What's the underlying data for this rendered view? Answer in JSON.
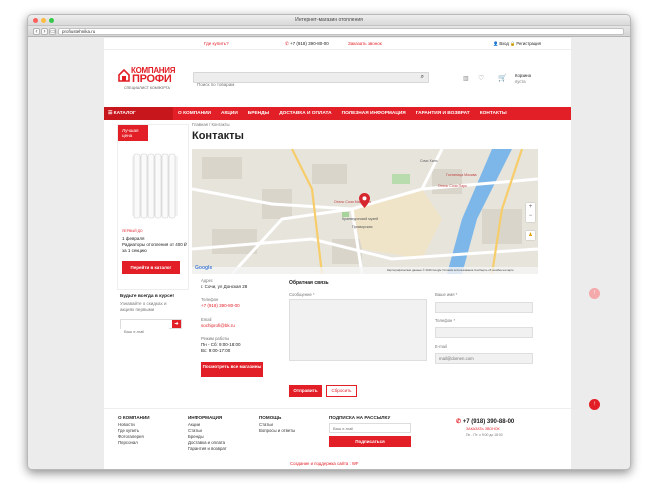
{
  "window": {
    "title": "Интернет-магазин отопления",
    "url": "profiustehnika.ru"
  },
  "header": {
    "where_to_buy": "Где купить?",
    "phone": "+7 (918) 390-80-00",
    "callback": "Заказать звонок",
    "login": "Вход",
    "register": "Регистрация",
    "logo_line1": "КОМПАНИЯ",
    "logo_line2": "ПРОФИ",
    "logo_tagline": "СПЕЦИАЛИСТ КОМФОРТА",
    "search_placeholder": "Поиск по товарам",
    "cart_title": "Корзина",
    "cart_status": "пуста"
  },
  "menu": {
    "catalog": "КАТАЛОГ",
    "items": [
      "О КОМПАНИИ",
      "АКЦИИ",
      "БРЕНДЫ",
      "ДОСТАВКА И ОПЛАТА",
      "ПОЛЕЗНАЯ ИНФОРМАЦИЯ",
      "ГАРАНТИЯ И ВОЗВРАТ",
      "КОНТАКТЫ"
    ]
  },
  "breadcrumb": [
    "Главная",
    "Контакты"
  ],
  "page_title": "Контакты",
  "promo": {
    "badge_line1": "Лучшая",
    "badge_line2": "цена",
    "tag": "ПЕРВЫЙ ДО",
    "date": "1 февраля",
    "text": "Радиаторы отопления от 400 ₽ за 1 секцию",
    "button": "Перейти в каталог"
  },
  "subscribe_side": {
    "title": "Будьте всегда в курсе!",
    "text": "Узнавайте о скидках и акциях первыми",
    "placeholder": "Ваш e-mail"
  },
  "contacts": {
    "address_label": "Адрес",
    "address": "г. Сочи, ул Донская 28",
    "phone_label": "Телефон",
    "phone": "+7 (918) 390-80-00",
    "email_label": "Email",
    "email": "sochiprofi@bk.ru",
    "hours_label": "Режим работы",
    "hours_weekdays": "Пн - Сб: 9:00-18:00",
    "hours_sunday": "Вс: 9:00-17:00",
    "stores_button": "Посмотреть все магазины"
  },
  "map": {
    "labels": [
      "Отель Сочи Магнолия",
      "Сочи Хилс",
      "Гостиница Москва",
      "Приморская",
      "Отель Сочи Парк",
      "Краеведческий музей"
    ],
    "footer_note": "Картографические данные © 2016 Google  Условия использования  Сообщить об ошибке на карте",
    "google": "Google",
    "zoom_in": "+",
    "zoom_out": "−"
  },
  "feedback": {
    "title": "Обратная связь",
    "message_label": "Сообщение *",
    "name_label": "Ваше имя *",
    "phone_label": "Телефон *",
    "email_label": "E-mail",
    "email_placeholder": "mail@domen.com",
    "submit": "Отправить",
    "reset": "Сбросить"
  },
  "footer": {
    "col1_title": "О КОМПАНИИ",
    "col1_items": [
      "Новости",
      "Где купить",
      "Фотогалерея",
      "Персонал"
    ],
    "col2_title": "ИНФОРМАЦИЯ",
    "col2_items": [
      "Акции",
      "Статьи",
      "Бренды",
      "Доставка и оплата",
      "Гарантия и возврат"
    ],
    "col3_title": "ПОМОЩЬ",
    "col3_items": [
      "Статьи",
      "Вопросы и ответы"
    ],
    "col4_title": "ПОДПИСКА НА РАССЫЛКУ",
    "email_placeholder": "Ваш e-mail",
    "subscribe_button": "Подписаться",
    "phone": "+7 (918) 390-88-00",
    "callback": "ЗАКАЗАТЬ ЗВОНОК",
    "hours": "Пн - Пт: с 9:00 до 18:00",
    "credits": "Создание и поддержка сайта : WF"
  },
  "colors": {
    "brand_red": "#e21e26",
    "dark_red": "#c8161d",
    "fab_pink": "#f4a9ab"
  }
}
